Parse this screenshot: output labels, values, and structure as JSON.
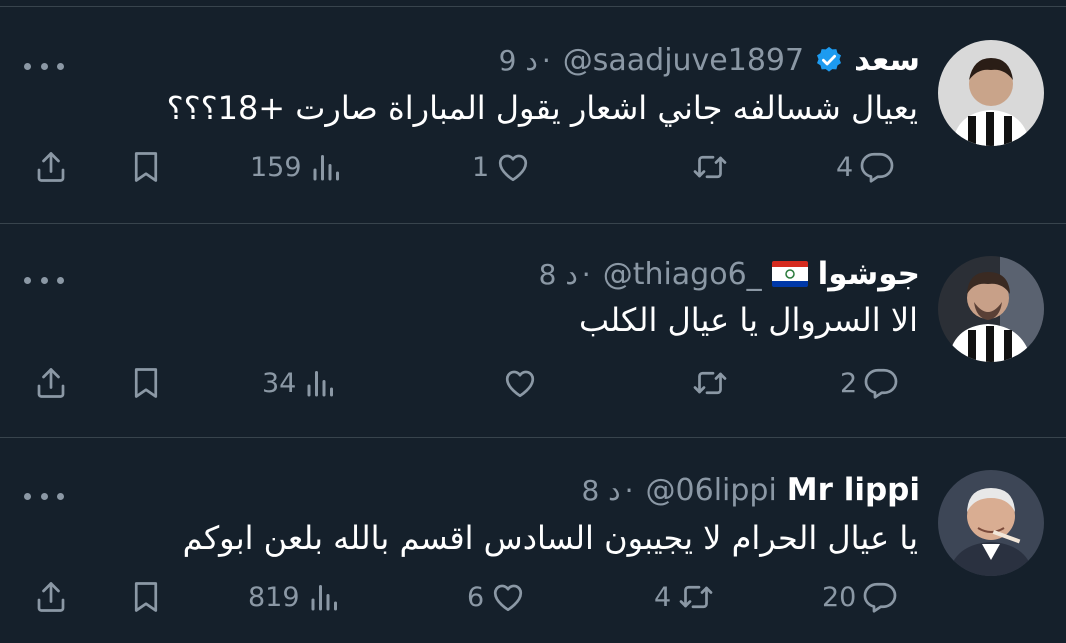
{
  "tweets": [
    {
      "name": "سعد",
      "handle": "@saadjuve1897",
      "time": "9 د",
      "separator": "·",
      "verified": true,
      "text": "يعيال شسالفه جاني اشعار يقول المباراة صارت +18؟؟؟",
      "replies": "4",
      "retweets": "",
      "likes": "1",
      "views": "159"
    },
    {
      "name": "جوشوا",
      "handle": "@thiago6_",
      "time": "8 د",
      "separator": "·",
      "flag_icon": "paraguay-flag-icon",
      "text": "الا السروال يا عيال الكلب",
      "replies": "2",
      "retweets": "",
      "likes": "",
      "views": "34"
    },
    {
      "name": "Mr lippi",
      "handle": "@06lippi",
      "time": "8 د",
      "separator": "·",
      "text": "يا عيال الحرام لا يجيبون السادس اقسم بالله بلعن ابوكم",
      "replies": "20",
      "retweets": "4",
      "likes": "6",
      "views": "819"
    }
  ],
  "colors": {
    "background": "#15202b",
    "divider": "#38444d",
    "secondary_text": "#8b98a5",
    "verified_badge": "#1d9bf0"
  },
  "icons": [
    "more-icon",
    "reply-icon",
    "retweet-icon",
    "like-icon",
    "views-icon",
    "bookmark-icon",
    "share-icon",
    "verified-badge-icon"
  ]
}
